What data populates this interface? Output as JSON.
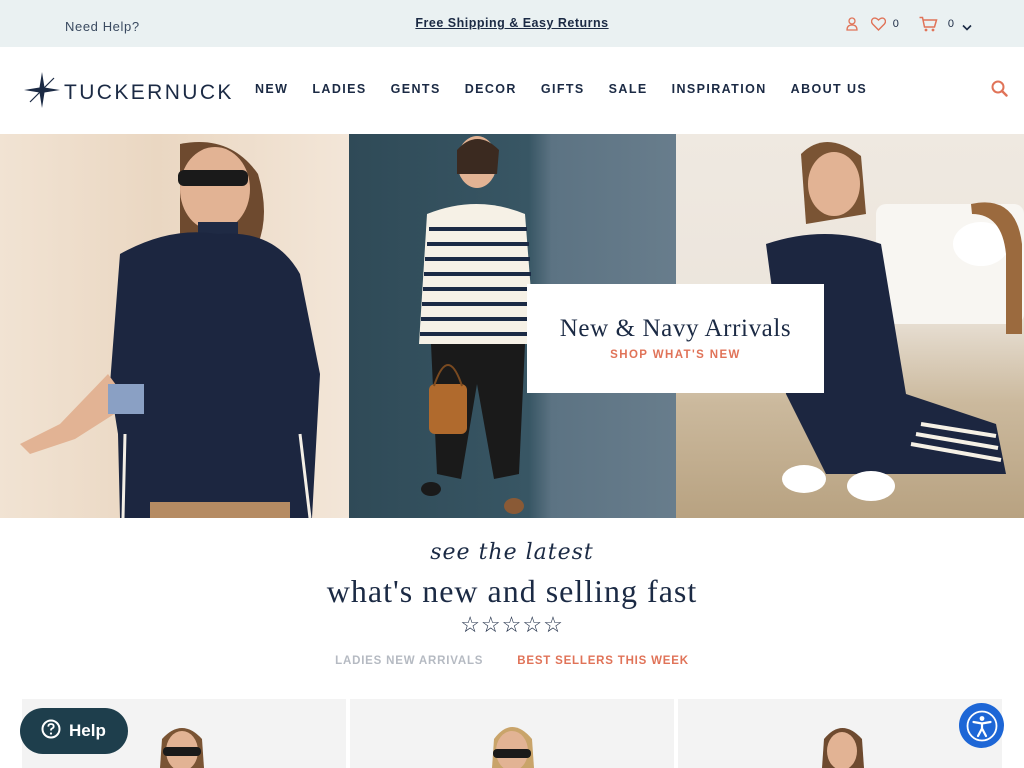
{
  "topbar": {
    "need_help": "Need Help?",
    "promo": "Free Shipping & Easy Returns",
    "wishlist_count": "0",
    "cart_count": "0"
  },
  "nav": {
    "brand": "TUCKERNUCK",
    "items": [
      "NEW",
      "LADIES",
      "GENTS",
      "DECOR",
      "GIFTS",
      "SALE",
      "INSPIRATION",
      "ABOUT US"
    ]
  },
  "hero": {
    "title": "New & Navy Arrivals",
    "link": "SHOP WHAT'S NEW"
  },
  "section": {
    "script_heading": "see the latest",
    "title": "what's new and selling fast",
    "stars": "☆☆☆☆☆",
    "tabs": [
      {
        "label": "LADIES NEW ARRIVALS",
        "active": false
      },
      {
        "label": "BEST SELLERS THIS WEEK",
        "active": true
      }
    ]
  },
  "help_button": {
    "label": "Help"
  },
  "colors": {
    "navy": "#1b2a44",
    "accent": "#e07358",
    "topbar_bg": "#eaf1f2",
    "help_bg": "#1e3e4c",
    "a11y_bg": "#1d66d6"
  },
  "icons": [
    "account-icon",
    "heart-icon",
    "cart-icon",
    "chevron-down-icon",
    "search-icon",
    "logo-star-icon",
    "help-question-icon",
    "accessibility-icon"
  ]
}
